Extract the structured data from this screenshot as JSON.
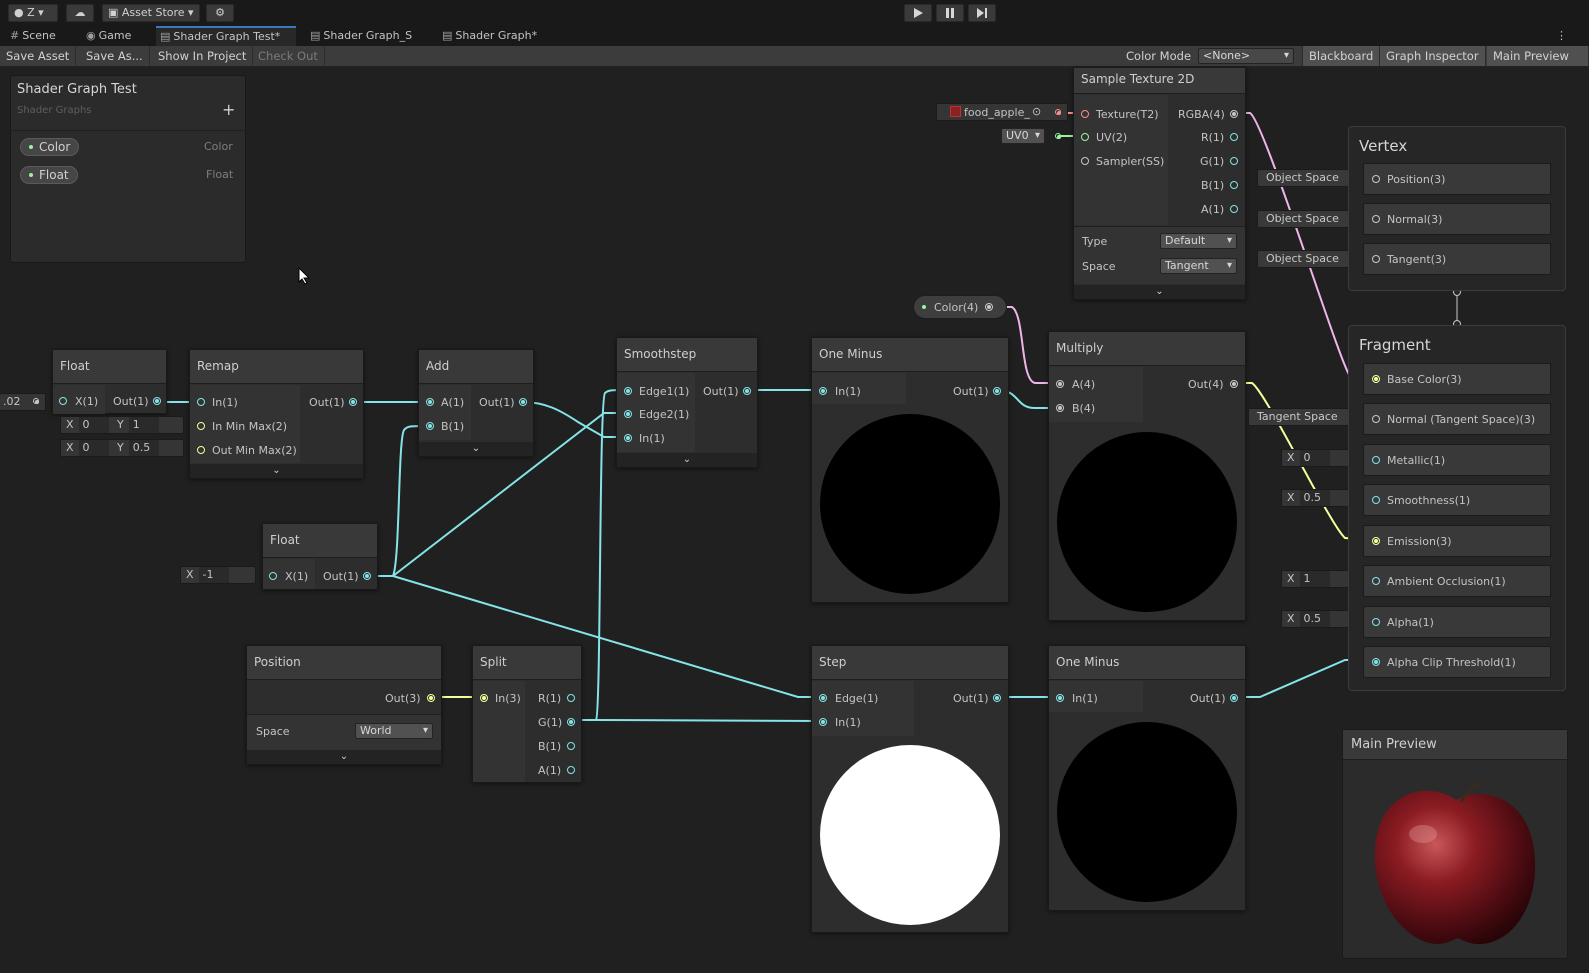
{
  "toolbar": {
    "account_label": "Z",
    "asset_store_label": "Asset Store"
  },
  "tabs": [
    {
      "label": "Scene"
    },
    {
      "label": "Game"
    },
    {
      "label": "Shader Graph Test*"
    },
    {
      "label": "Shader Graph_S"
    },
    {
      "label": "Shader Graph*"
    }
  ],
  "graph_toolbar": {
    "save_asset": "Save Asset",
    "save_as": "Save As...",
    "show_in_project": "Show In Project",
    "check_out": "Check Out",
    "color_mode_label": "Color Mode",
    "color_mode_value": "<None>",
    "blackboard": "Blackboard",
    "graph_inspector": "Graph Inspector",
    "main_preview": "Main Preview"
  },
  "blackboard": {
    "title": "Shader Graph Test",
    "subtitle": "Shader Graphs",
    "add_symbol": "+",
    "properties": [
      {
        "name": "Color",
        "type": "Color"
      },
      {
        "name": "Float",
        "type": "Float"
      }
    ]
  },
  "nodes": {
    "float1": {
      "title": "Float",
      "in": "X(1)",
      "out": "Out(1)",
      "input_value": ".02"
    },
    "remap": {
      "title": "Remap",
      "in1": "In(1)",
      "in2": "In Min Max(2)",
      "in3": "Out Min Max(2)",
      "out": "Out(1)",
      "field1": {
        "x_label": "X",
        "x": "0",
        "y_label": "Y",
        "y": "1"
      },
      "field2": {
        "x_label": "X",
        "x": "0",
        "y_label": "Y",
        "y": "0.5"
      }
    },
    "add": {
      "title": "Add",
      "in1": "A(1)",
      "in2": "B(1)",
      "out": "Out(1)"
    },
    "float2": {
      "title": "Float",
      "in": "X(1)",
      "out": "Out(1)",
      "field_label": "X",
      "field_value": "-1"
    },
    "position": {
      "title": "Position",
      "out": "Out(3)",
      "space_label": "Space",
      "space_value": "World"
    },
    "split": {
      "title": "Split",
      "in": "In(3)",
      "outs": [
        "R(1)",
        "G(1)",
        "B(1)",
        "A(1)"
      ]
    },
    "smoothstep": {
      "title": "Smoothstep",
      "in1": "Edge1(1)",
      "in2": "Edge2(1)",
      "in3": "In(1)",
      "out": "Out(1)"
    },
    "oneminus1": {
      "title": "One Minus",
      "in": "In(1)",
      "out": "Out(1)"
    },
    "step": {
      "title": "Step",
      "in1": "Edge(1)",
      "in2": "In(1)",
      "out": "Out(1)"
    },
    "multiply": {
      "title": "Multiply",
      "in1": "A(4)",
      "in2": "B(4)",
      "out": "Out(4)"
    },
    "oneminus2": {
      "title": "One Minus",
      "in": "In(1)",
      "out": "Out(1)"
    },
    "sample": {
      "title": "Sample Texture 2D",
      "in1": "Texture(T2)",
      "in2": "UV(2)",
      "in3": "Sampler(SS)",
      "outs": [
        "RGBA(4)",
        "R(1)",
        "G(1)",
        "B(1)",
        "A(1)"
      ],
      "type_label": "Type",
      "type_value": "Default",
      "space_label": "Space",
      "space_value": "Tangent",
      "texture_value": "food_apple_",
      "uv_value": "UV0"
    },
    "color_prop": {
      "label": "Color(4)"
    }
  },
  "vertex": {
    "title": "Vertex",
    "blocks": [
      "Position(3)",
      "Normal(3)",
      "Tangent(3)"
    ],
    "chips": [
      "Object Space",
      "Object Space",
      "Object Space"
    ]
  },
  "fragment": {
    "title": "Fragment",
    "blocks": [
      "Base Color(3)",
      "Normal (Tangent Space)(3)",
      "Metallic(1)",
      "Smoothness(1)",
      "Emission(3)",
      "Ambient Occlusion(1)",
      "Alpha(1)",
      "Alpha Clip Threshold(1)"
    ],
    "normal_chip": "Tangent Space",
    "metallic": {
      "label": "X",
      "value": "0"
    },
    "smoothness": {
      "label": "X",
      "value": "0.5"
    },
    "ao": {
      "label": "X",
      "value": "1"
    },
    "alpha": {
      "label": "X",
      "value": "0.5"
    }
  },
  "main_preview": {
    "title": "Main Preview"
  },
  "colors": {
    "float_wire": "#84e4e7",
    "vector_wire": "#f6ff9a",
    "color_wire": "#f0b4e8",
    "accent_tab": "#3a79bb"
  }
}
